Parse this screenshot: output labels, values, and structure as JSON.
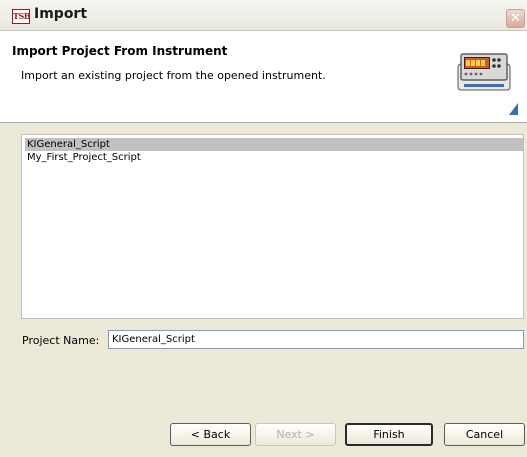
{
  "window": {
    "title": "Import",
    "app_icon_text": "TSB"
  },
  "header": {
    "title": "Import Project From Instrument",
    "description": "Import an existing project from the opened instrument.",
    "icon": "instrument-icon",
    "accent_color": "#3c6db4"
  },
  "project_list": {
    "items": [
      {
        "label": "KIGeneral_Script",
        "selected": true
      },
      {
        "label": "My_First_Project_Script",
        "selected": false
      }
    ]
  },
  "project_name": {
    "label": "Project Name:",
    "value": "KIGeneral_Script"
  },
  "buttons": {
    "back": "< Back",
    "next": "Next >",
    "finish": "Finish",
    "cancel": "Cancel"
  }
}
